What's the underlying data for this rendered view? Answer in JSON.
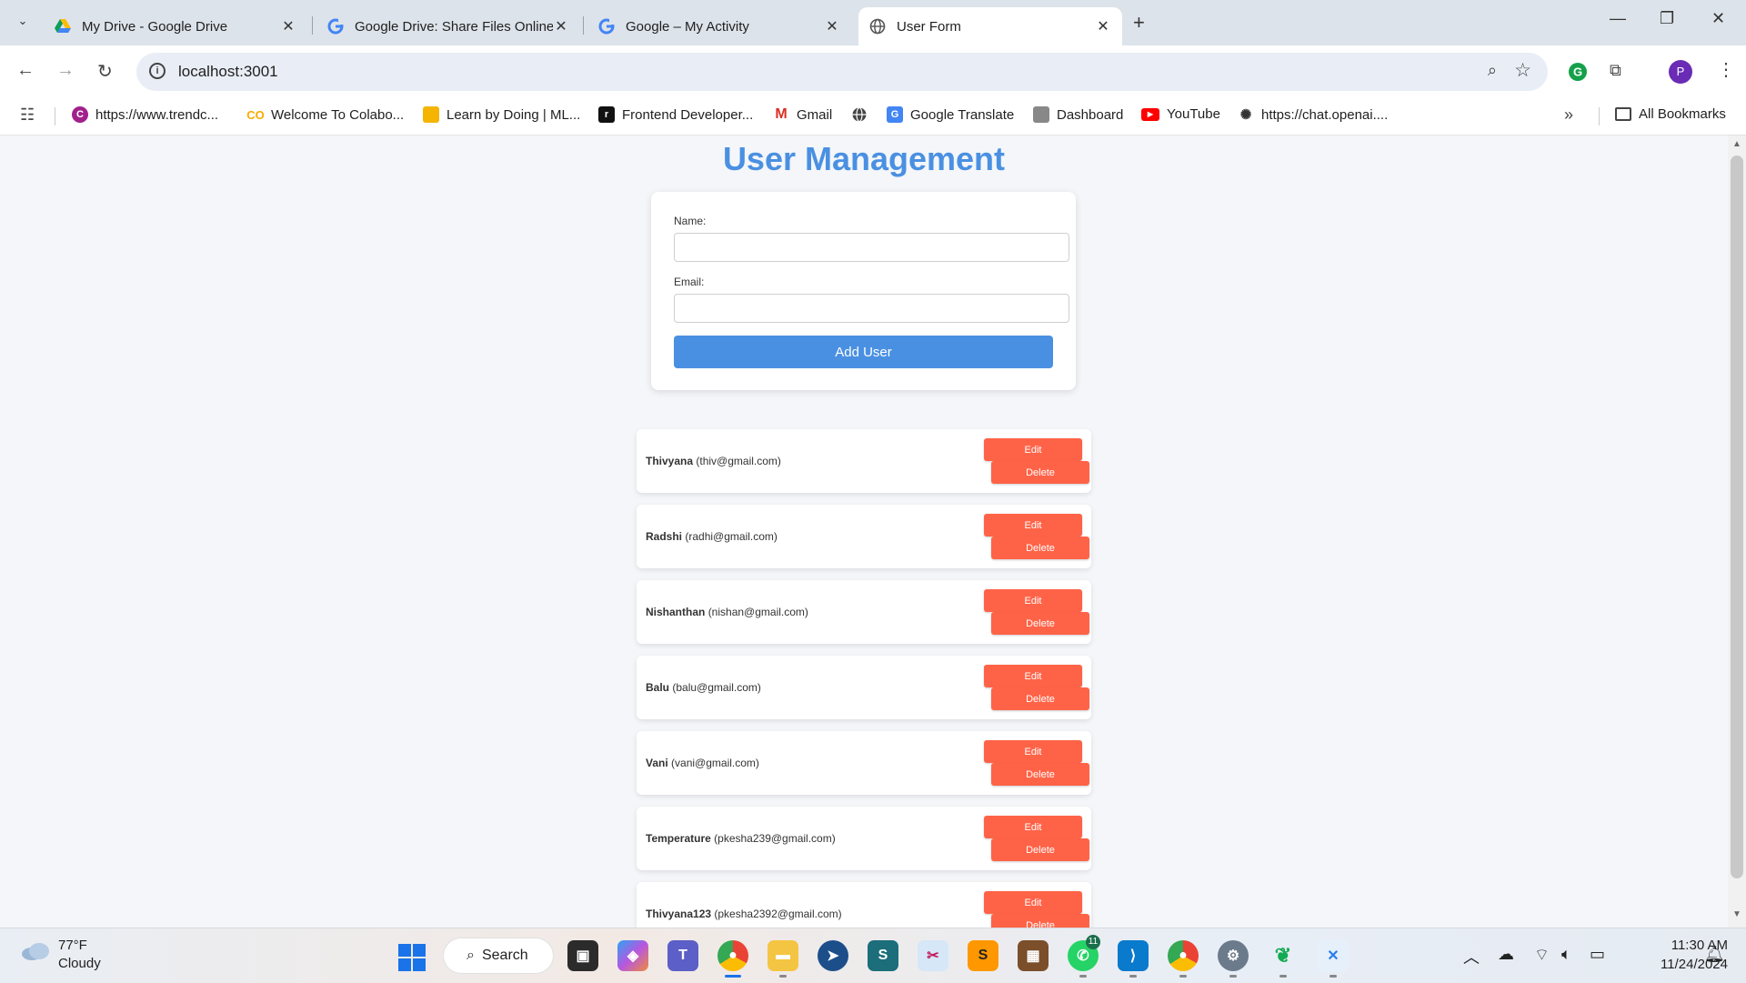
{
  "browser": {
    "tabs": [
      {
        "title": "My Drive - Google Drive",
        "active": false,
        "icon": "google-drive-icon"
      },
      {
        "title": "Google Drive: Share Files Online",
        "active": false,
        "icon": "google-g-icon"
      },
      {
        "title": "Google – My Activity",
        "active": false,
        "icon": "google-g-icon"
      },
      {
        "title": "User Form",
        "active": true,
        "icon": "globe-icon"
      }
    ],
    "address": "localhost:3001",
    "profile_initial": "P",
    "bookmarks": [
      {
        "label": "https://www.trendc...",
        "icon": "trendc-icon"
      },
      {
        "label": "Welcome To Colabo...",
        "icon": "colab-icon"
      },
      {
        "label": "Learn by Doing | ML...",
        "icon": "ml-icon"
      },
      {
        "label": "Frontend Developer...",
        "icon": "frontend-icon"
      },
      {
        "label": "Gmail",
        "icon": "gmail-icon"
      },
      {
        "label": "",
        "icon": "globe-icon"
      },
      {
        "label": "Google Translate",
        "icon": "translate-icon"
      },
      {
        "label": "Dashboard",
        "icon": "dashboard-icon"
      },
      {
        "label": "YouTube",
        "icon": "youtube-icon"
      },
      {
        "label": "https://chat.openai....",
        "icon": "openai-icon"
      }
    ],
    "all_bookmarks": "All Bookmarks"
  },
  "page": {
    "title": "User Management",
    "form": {
      "name_label": "Name:",
      "name_value": "",
      "email_label": "Email:",
      "email_value": "",
      "submit_label": "Add User"
    },
    "users": [
      {
        "name": "Thivyana",
        "email": "(thiv@gmail.com)"
      },
      {
        "name": "Radshi",
        "email": "(radhi@gmail.com)"
      },
      {
        "name": "Nishanthan",
        "email": "(nishan@gmail.com)"
      },
      {
        "name": "Balu",
        "email": "(balu@gmail.com)"
      },
      {
        "name": "Vani",
        "email": "(vani@gmail.com)"
      },
      {
        "name": "Temperature",
        "email": "(pkesha239@gmail.com)"
      },
      {
        "name": "Thivyana123",
        "email": "(pkesha2392@gmail.com)"
      }
    ],
    "edit_label": "Edit",
    "delete_label": "Delete"
  },
  "taskbar": {
    "weather_temp": "77°F",
    "weather_condition": "Cloudy",
    "search_label": "Search",
    "whatsapp_badge": "11",
    "time": "11:30 AM",
    "date": "11/24/2024"
  },
  "colors": {
    "accent": "#4a90e2",
    "danger": "#ff6347",
    "page_bg": "#f4f6f9"
  }
}
